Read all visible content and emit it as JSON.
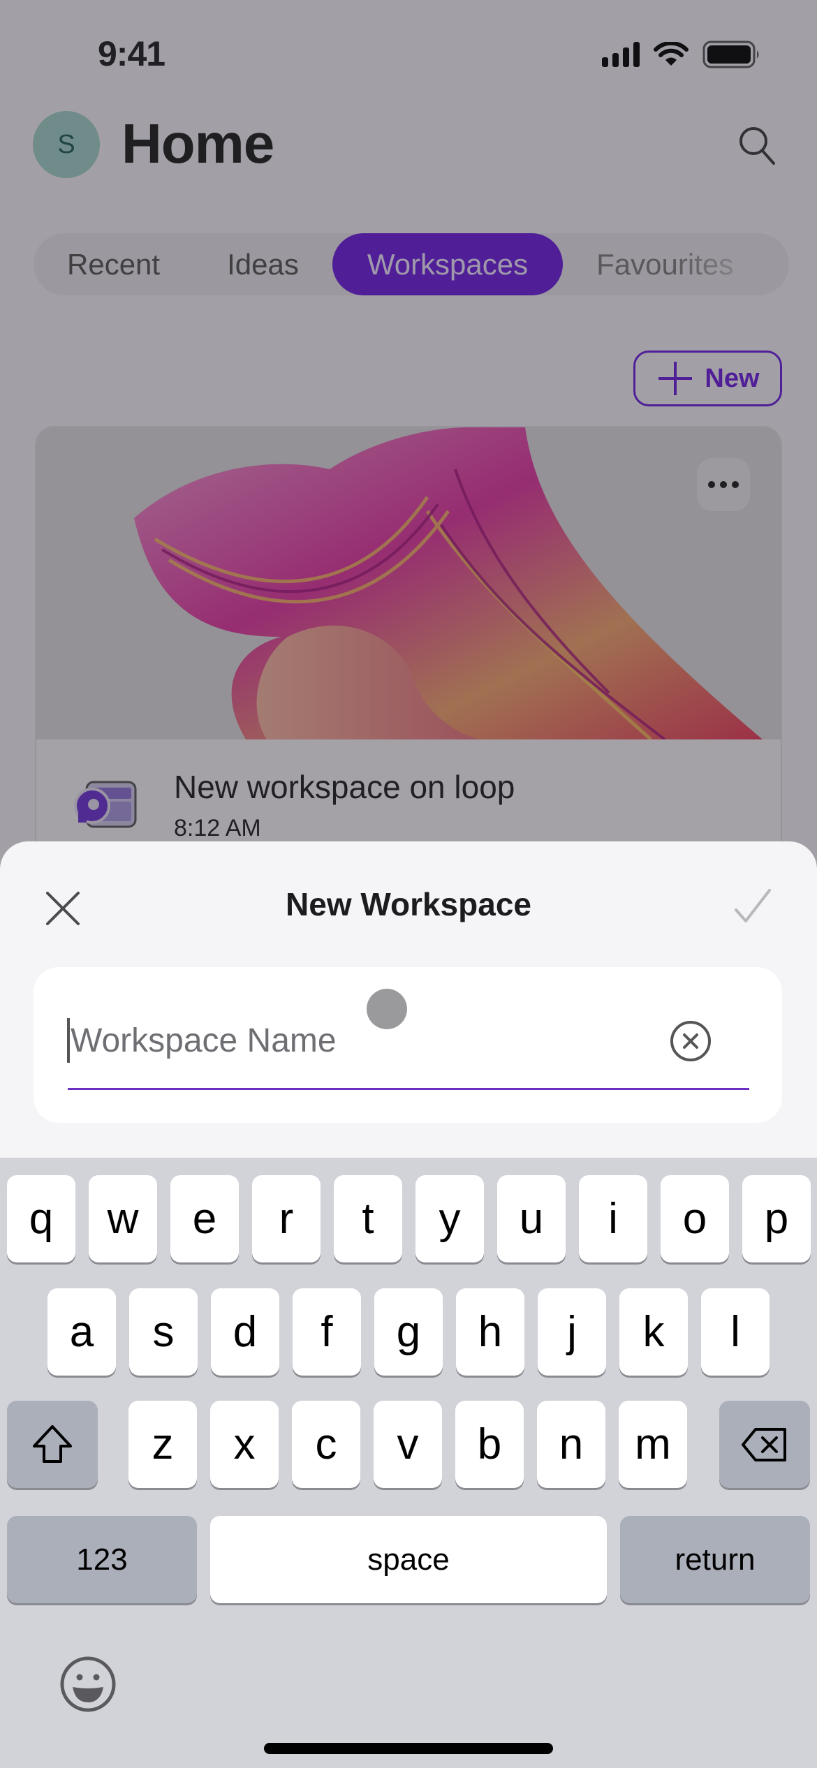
{
  "status_bar": {
    "time": "9:41"
  },
  "header": {
    "avatar_initial": "S",
    "title": "Home",
    "search_icon": "search-icon"
  },
  "tabs": [
    {
      "label": "Recent",
      "active": false
    },
    {
      "label": "Ideas",
      "active": false
    },
    {
      "label": "Workspaces",
      "active": true
    },
    {
      "label": "Favourites",
      "active": false
    }
  ],
  "toolbar": {
    "new_label": "New"
  },
  "workspace_card": {
    "title": "New workspace on loop",
    "time": "8:12 AM",
    "more_icon": "more-horizontal-icon"
  },
  "sheet": {
    "title": "New Workspace",
    "close_icon": "close-icon",
    "confirm_icon": "checkmark-icon",
    "input": {
      "value": "",
      "placeholder": "Workspace Name"
    }
  },
  "keyboard": {
    "row1": [
      "q",
      "w",
      "e",
      "r",
      "t",
      "y",
      "u",
      "i",
      "o",
      "p"
    ],
    "row2": [
      "a",
      "s",
      "d",
      "f",
      "g",
      "h",
      "j",
      "k",
      "l"
    ],
    "row3": [
      "z",
      "x",
      "c",
      "v",
      "b",
      "n",
      "m"
    ],
    "numbers_label": "123",
    "space_label": "space",
    "return_label": "return"
  },
  "colors": {
    "accent": "#6b1be0",
    "avatar_bg": "#9fcfc9",
    "keyboard_bg": "#d1d3d9"
  }
}
